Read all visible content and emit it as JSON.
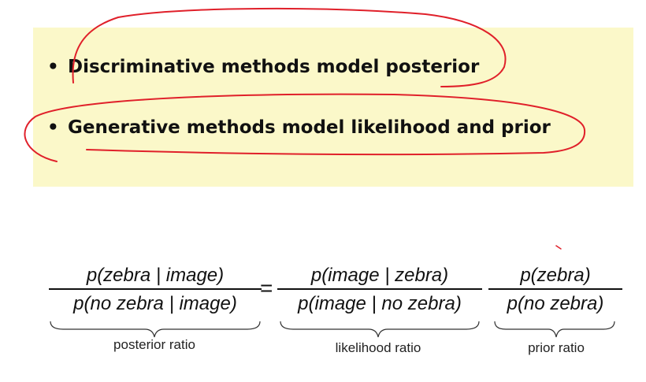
{
  "bullets": [
    {
      "marker": "•",
      "text": "Discriminative methods model posterior"
    },
    {
      "marker": "•",
      "text": "Generative methods model likelihood and prior"
    }
  ],
  "equation": {
    "lhs_numerator": "p(zebra | image)",
    "lhs_denominator": "p(no zebra | image)",
    "equals": "=",
    "mid_numerator": "p(image |  zebra)",
    "mid_denominator": "p(image | no zebra)",
    "rhs_numerator": "p(zebra)",
    "rhs_denominator": "p(no zebra)"
  },
  "labels": {
    "posterior": "posterior ratio",
    "likelihood": "likelihood ratio",
    "prior": "prior ratio"
  },
  "colors": {
    "highlight_background": "#fbf8c9",
    "annotation_ink": "#e0202a"
  }
}
